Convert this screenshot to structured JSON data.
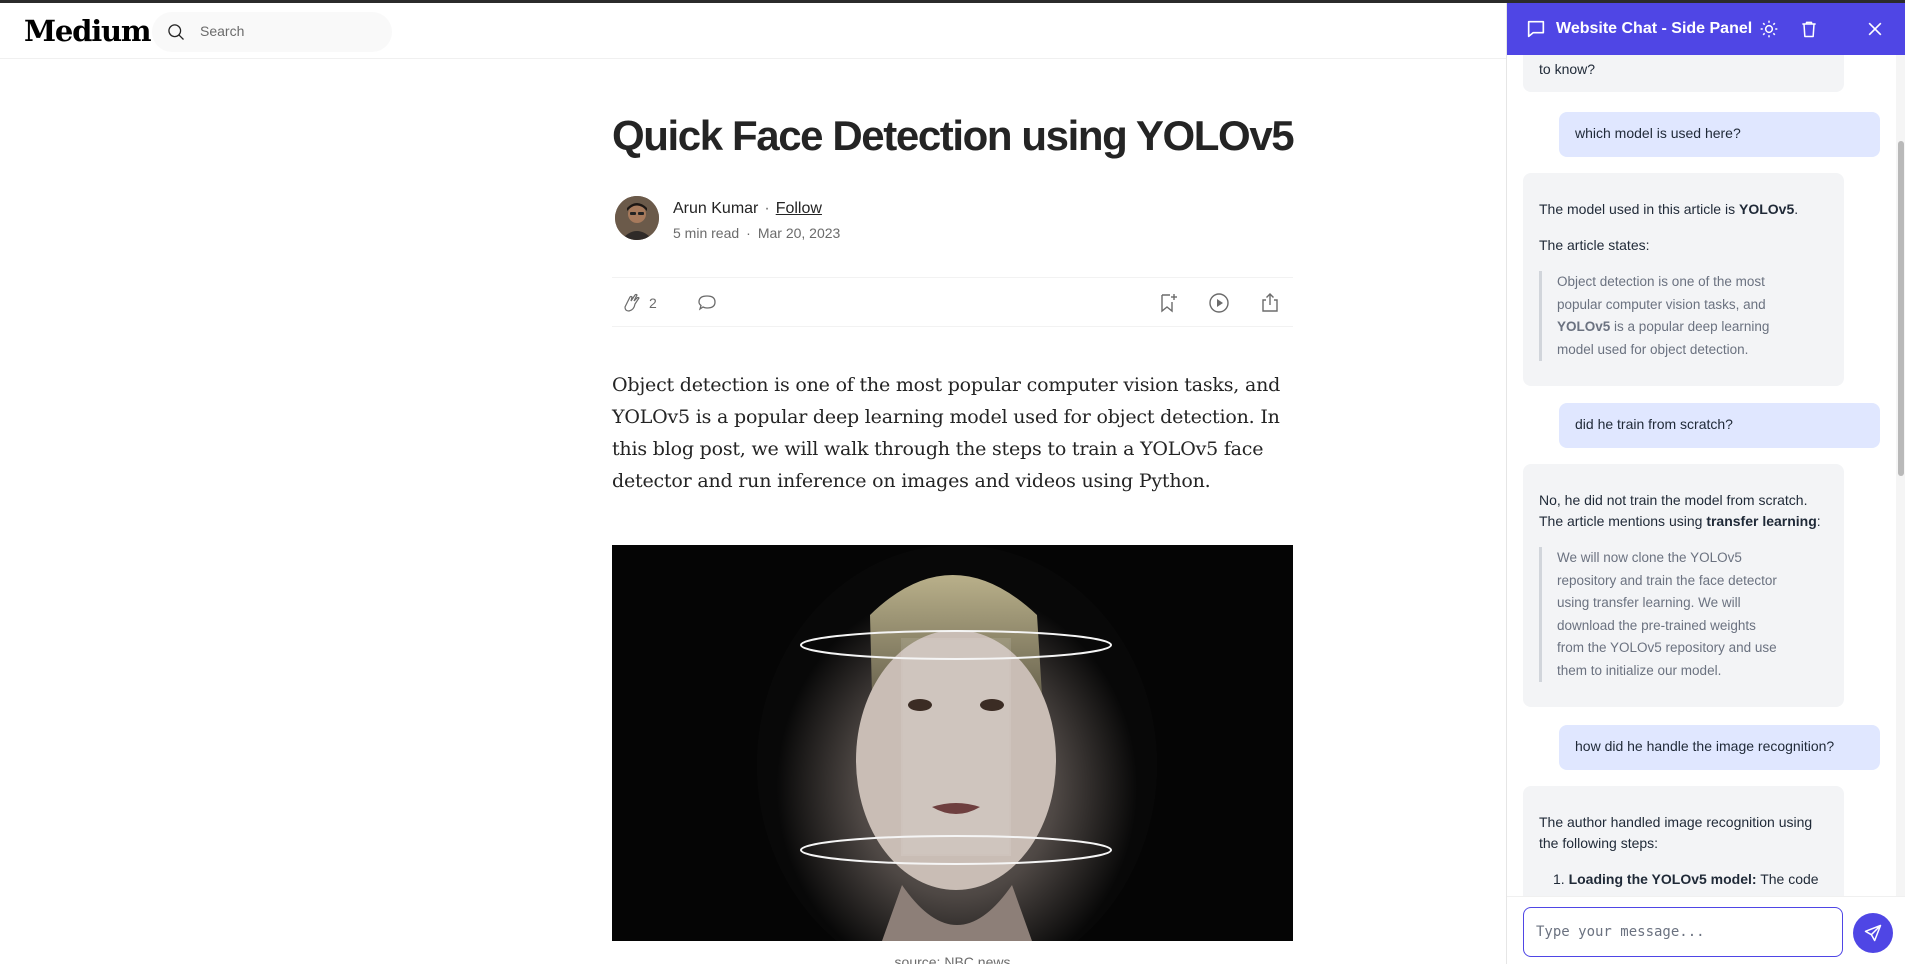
{
  "header": {
    "logo": "Medium",
    "search_placeholder": "Search"
  },
  "article": {
    "title": "Quick Face Detection using YOLOv5",
    "author": "Arun Kumar",
    "follow_label": "Follow",
    "read_time": "5 min read",
    "date": "Mar 20, 2023",
    "clap_count": "2",
    "intro": "Object detection is one of the most popular computer vision tasks, and YOLOv5 is a popular deep learning model used for object detection. In this blog post, we will walk through the steps to train a YOLOv5 face detector and run inference on images and videos using Python.",
    "image_caption": "source: NBC news"
  },
  "panel": {
    "title": "Website Chat - Side Panel",
    "input_placeholder": "Type your message...",
    "accent": "#4f46e5",
    "messages": {
      "m0_tail": "to know?",
      "m1_user": "which model is used here?",
      "m2_a": "The model used in this article is",
      "m2_b": "YOLOv5",
      "m2_c": ".",
      "m2_d": "The article states:",
      "m2_q1": "Object detection is one of the most popular computer vision tasks, and",
      "m2_q2": "YOLOv5",
      "m2_q3": "is a popular deep learning model used for object detection.",
      "m3_user": "did he train from scratch?",
      "m4_a": "No, he did not train the model from scratch. The article mentions using",
      "m4_b": "transfer learning",
      "m4_c": ":",
      "m4_q": "We will now clone the YOLOv5 repository and train the face detector using transfer learning. We will download the pre-trained weights from the YOLOv5 repository and use them to initialize our model.",
      "m5_user": "how did he handle the image recognition?",
      "m6_a": "The author handled image recognition using the following steps:",
      "m6_li_num": "1.",
      "m6_li_b": "Loading the YOLOv5 model:",
      "m6_li_c": "The code"
    }
  }
}
